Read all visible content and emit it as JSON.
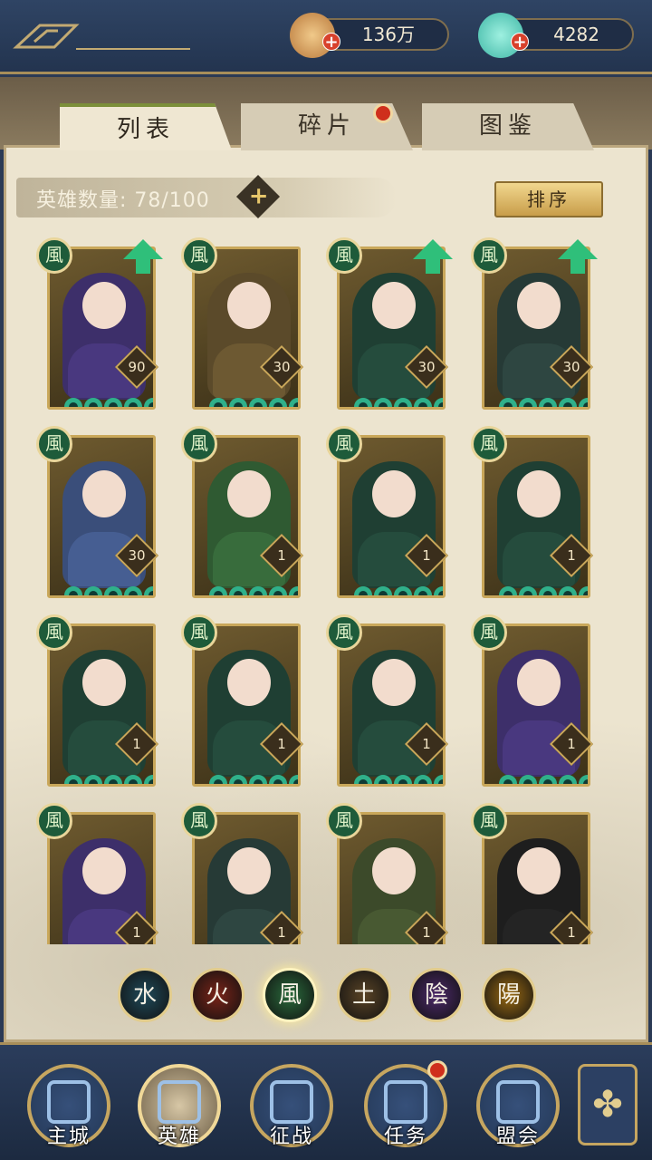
{
  "resources": [
    {
      "icon": "copper-coin-icon",
      "value": "136万"
    },
    {
      "icon": "jade-pouch-icon",
      "value": "4282"
    }
  ],
  "tabs": [
    {
      "label": "列表",
      "active": true
    },
    {
      "label": "碎片",
      "badge": true
    },
    {
      "label": "图鉴"
    }
  ],
  "hero_count": {
    "label": "英雄数量: 78/100"
  },
  "sort_label": "排序",
  "element_glyph": "風",
  "heroes": [
    {
      "level": "90",
      "upgrade": true,
      "color": "#3d2f6a"
    },
    {
      "level": "30",
      "upgrade": false,
      "color": "#5b4a2a"
    },
    {
      "level": "30",
      "upgrade": true,
      "color": "#1f3f33"
    },
    {
      "level": "30",
      "upgrade": true,
      "color": "#263a36"
    },
    {
      "level": "30",
      "upgrade": false,
      "color": "#3a4e7a"
    },
    {
      "level": "1",
      "upgrade": false,
      "color": "#2f5a32"
    },
    {
      "level": "1",
      "upgrade": false,
      "color": "#1f3f33"
    },
    {
      "level": "1",
      "upgrade": false,
      "color": "#1f3f33"
    },
    {
      "level": "1",
      "upgrade": false,
      "color": "#1f3f33"
    },
    {
      "level": "1",
      "upgrade": false,
      "color": "#1f3f33"
    },
    {
      "level": "1",
      "upgrade": false,
      "color": "#1f3f33"
    },
    {
      "level": "1",
      "upgrade": false,
      "color": "#3d2f6a"
    },
    {
      "level": "1",
      "upgrade": false,
      "color": "#3d2f6a"
    },
    {
      "level": "1",
      "upgrade": false,
      "color": "#263a36"
    },
    {
      "level": "1",
      "upgrade": false,
      "color": "#3c4a2a"
    },
    {
      "level": "1",
      "upgrade": false,
      "color": "#1e1e1e"
    }
  ],
  "elements": [
    {
      "glyph": "水",
      "name": "water",
      "color": "#1f4a5a"
    },
    {
      "glyph": "火",
      "name": "fire",
      "color": "#7a2418"
    },
    {
      "glyph": "風",
      "name": "wind",
      "color": "#2a6b3c"
    },
    {
      "glyph": "土",
      "name": "earth",
      "color": "#5a4426"
    },
    {
      "glyph": "陰",
      "name": "yin",
      "color": "#4d2a6a"
    },
    {
      "glyph": "陽",
      "name": "yang",
      "color": "#9a6a12"
    }
  ],
  "nav": [
    {
      "label": "主城"
    },
    {
      "label": "英雄",
      "active": true
    },
    {
      "label": "征战"
    },
    {
      "label": "任务",
      "badge": true
    },
    {
      "label": "盟会"
    }
  ],
  "menu_glyph": "✤"
}
